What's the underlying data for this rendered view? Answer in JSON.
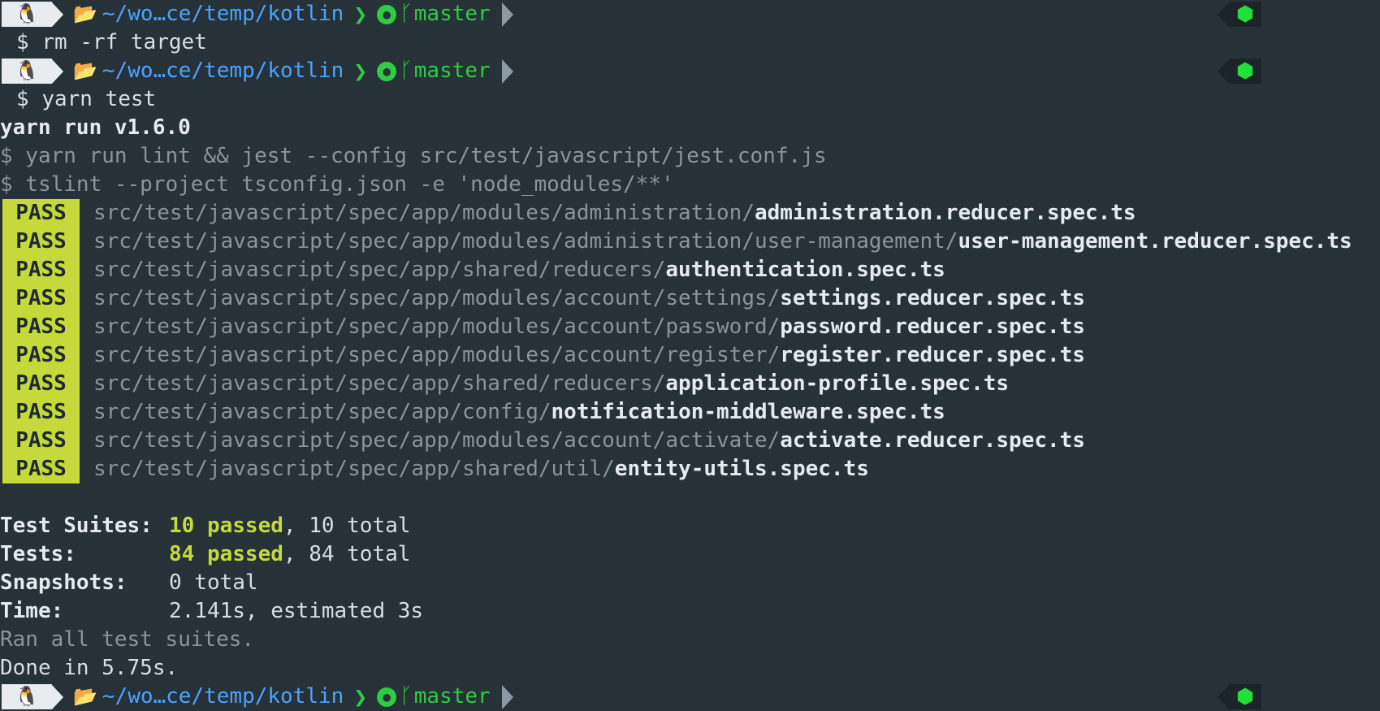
{
  "prompt": {
    "os_icon": "linux-penguin-icon",
    "dir_icon": "folder-open-icon",
    "path": "~/wo…ce/temp/kotlin",
    "separator": "❯",
    "git_icon": "github-icon",
    "branch_icon": "branch-icon",
    "branch": "master",
    "badge_icon": "node-icon"
  },
  "commands": [
    {
      "prefix": "$",
      "text": "rm -rf target"
    },
    {
      "prefix": "$",
      "text": "yarn test"
    }
  ],
  "output": {
    "yarn_run": "yarn run v1.6.0",
    "cmd_lines": [
      "$ yarn run lint && jest --config src/test/javascript/jest.conf.js",
      "$ tslint --project tsconfig.json -e 'node_modules/**'"
    ],
    "pass_label": "PASS",
    "tests": [
      {
        "dir": "src/test/javascript/spec/app/modules/administration/",
        "file": "administration.reducer.spec.ts"
      },
      {
        "dir": "src/test/javascript/spec/app/modules/administration/user-management/",
        "file": "user-management.reducer.spec.ts"
      },
      {
        "dir": "src/test/javascript/spec/app/shared/reducers/",
        "file": "authentication.spec.ts"
      },
      {
        "dir": "src/test/javascript/spec/app/modules/account/settings/",
        "file": "settings.reducer.spec.ts"
      },
      {
        "dir": "src/test/javascript/spec/app/modules/account/password/",
        "file": "password.reducer.spec.ts"
      },
      {
        "dir": "src/test/javascript/spec/app/modules/account/register/",
        "file": "register.reducer.spec.ts"
      },
      {
        "dir": "src/test/javascript/spec/app/shared/reducers/",
        "file": "application-profile.spec.ts"
      },
      {
        "dir": "src/test/javascript/spec/app/config/",
        "file": "notification-middleware.spec.ts"
      },
      {
        "dir": "src/test/javascript/spec/app/modules/account/activate/",
        "file": "activate.reducer.spec.ts"
      },
      {
        "dir": "src/test/javascript/spec/app/shared/util/",
        "file": "entity-utils.spec.ts"
      }
    ],
    "summary": {
      "suites_label": "Test Suites:",
      "suites_passed": "10 passed",
      "suites_total": ", 10 total",
      "tests_label": "Tests:",
      "tests_passed": "84 passed",
      "tests_total": ", 84 total",
      "snapshots_label": "Snapshots:",
      "snapshots_value": "0 total",
      "time_label": "Time:",
      "time_value": "2.141s, estimated 3s"
    },
    "ran_all": "Ran all test suites.",
    "done": "Done in 5.75s."
  }
}
